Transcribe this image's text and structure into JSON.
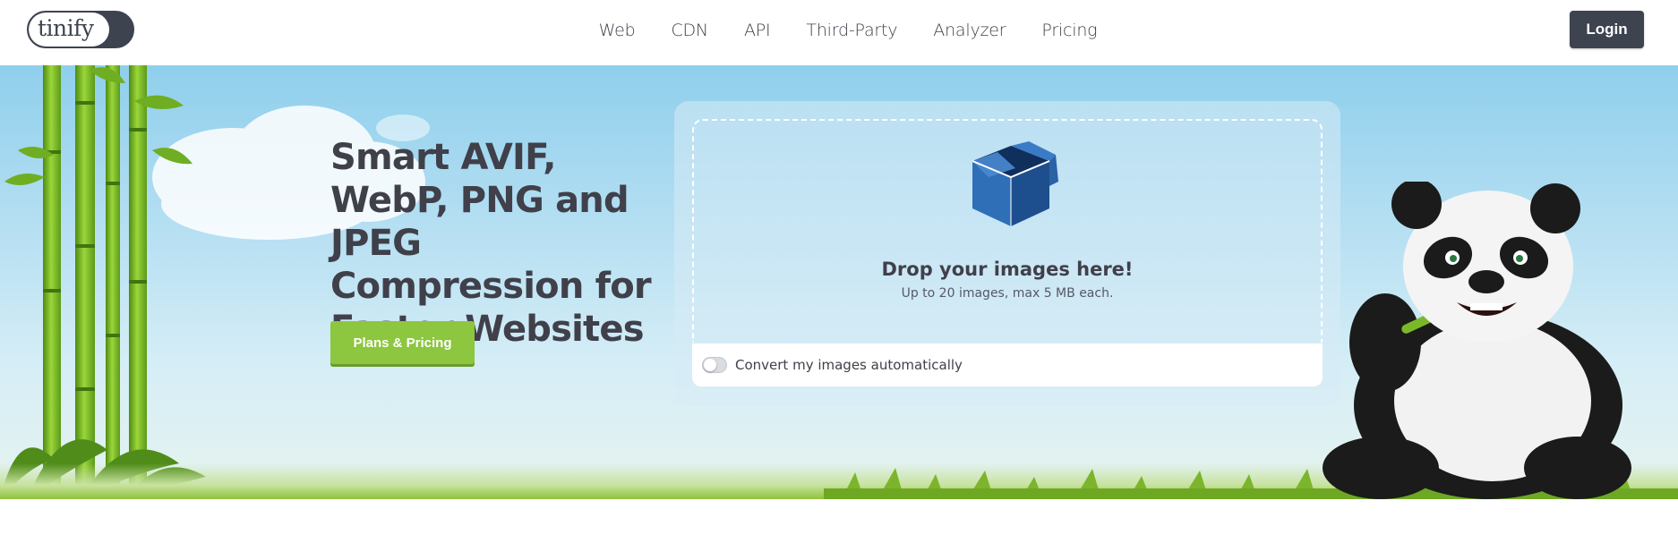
{
  "header": {
    "logo_text": "tinify",
    "nav": [
      "Web",
      "CDN",
      "API",
      "Third-Party",
      "Analyzer",
      "Pricing"
    ],
    "login_label": "Login"
  },
  "hero": {
    "headline": "Smart AVIF, WebP, PNG and JPEG Compression for Faster Websites",
    "plans_button": "Plans & Pricing"
  },
  "dropzone": {
    "title": "Drop your images here!",
    "subtitle": "Up to 20 images, max 5 MB each.",
    "convert_label": "Convert my images automatically",
    "convert_enabled": false,
    "box_icon": "open-box-icon"
  },
  "colors": {
    "accent_green": "#8dc63f",
    "dark": "#3e4350",
    "sky": "#8fcfec"
  }
}
